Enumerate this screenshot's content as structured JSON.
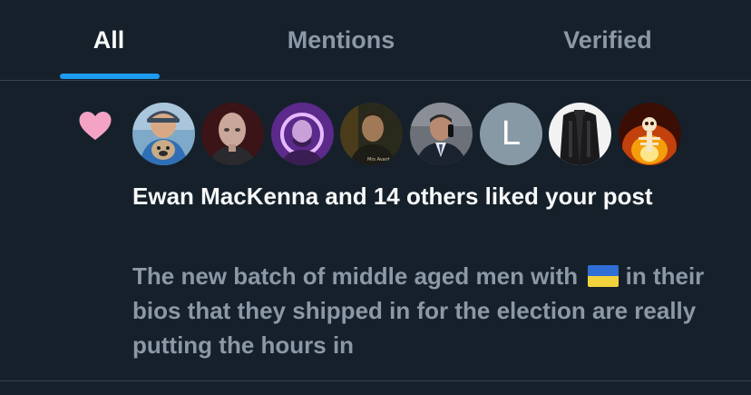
{
  "tabs": [
    {
      "label": "All",
      "active": true
    },
    {
      "label": "Mentions",
      "active": false
    },
    {
      "label": "Verified",
      "active": false
    }
  ],
  "notification": {
    "type_icon": "heart-icon",
    "avatars": [
      {
        "name": "avatar-user-1",
        "kind": "photo"
      },
      {
        "name": "avatar-user-2",
        "kind": "photo"
      },
      {
        "name": "avatar-user-3",
        "kind": "photo"
      },
      {
        "name": "avatar-user-4",
        "kind": "photo"
      },
      {
        "name": "avatar-user-5",
        "kind": "photo"
      },
      {
        "name": "avatar-user-6",
        "kind": "letter",
        "letter": "L"
      },
      {
        "name": "avatar-user-7",
        "kind": "photo"
      },
      {
        "name": "avatar-user-8",
        "kind": "photo"
      }
    ],
    "headline": "Ewan MacKenna and 14 others liked your post",
    "post_text": "The new batch of middle aged men with",
    "post_flag": "ukraine-flag-icon",
    "post_text_rest": "in their bios that they shipped in for the election are really putting the hours in"
  },
  "colors": {
    "background": "#15202b",
    "accent": "#1d9bf0",
    "heart": "#f4a3c4",
    "text_primary": "#f7f9f9",
    "text_secondary": "#8b98a5",
    "divider": "#38444d"
  }
}
